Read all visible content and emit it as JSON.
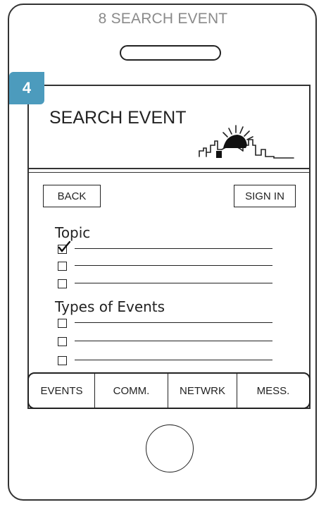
{
  "phone": {
    "title": "8 SEARCH EVENT"
  },
  "badge": {
    "number": "4"
  },
  "header": {
    "title": "SEARCH EVENT",
    "logo_icon": "city-skyline-sun-icon"
  },
  "buttons": {
    "back": "BACK",
    "sign_in": "SIGN IN"
  },
  "topic": {
    "label": "Topic",
    "items": [
      {
        "checked": true,
        "text": ""
      },
      {
        "checked": false,
        "text": ""
      },
      {
        "checked": false,
        "text": ""
      }
    ]
  },
  "types": {
    "label": "Types of Events",
    "items": [
      {
        "checked": false,
        "text": ""
      },
      {
        "checked": false,
        "text": ""
      },
      {
        "checked": false,
        "text": ""
      }
    ]
  },
  "nav": {
    "tabs": [
      "EVENTS",
      "COMM.",
      "NETWRK",
      "MESS."
    ]
  },
  "colors": {
    "badge": "#4c9bbd",
    "outline": "#222222",
    "title_gray": "#8a8a8a"
  }
}
